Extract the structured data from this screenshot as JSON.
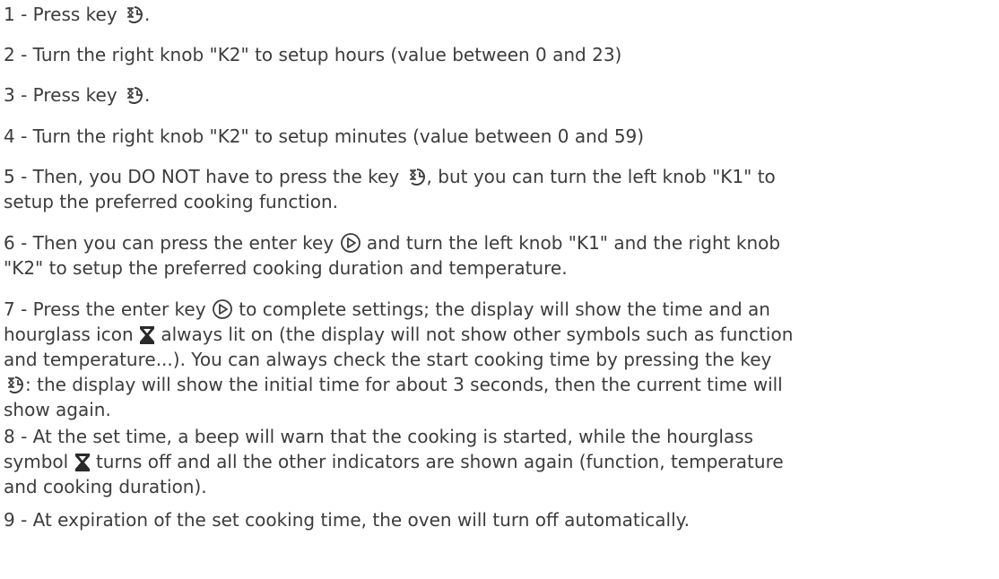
{
  "steps": [
    {
      "lines": [
        [
          "1 - Press key ",
          "timer-icon",
          "."
        ]
      ]
    },
    {
      "lines": [
        [
          "2 - Turn the right knob \"K2\" to setup hours (value between 0 and 23)"
        ]
      ]
    },
    {
      "lines": [
        [
          "3 - Press key ",
          "timer-icon",
          "."
        ]
      ]
    },
    {
      "lines": [
        [
          "4 - Turn the right knob \"K2\" to setup minutes (value between 0 and 59)"
        ]
      ]
    },
    {
      "lines": [
        [
          "5 - Then, you DO NOT have to press the key ",
          "timer-icon",
          ", but you can turn the left knob \"K1\" to"
        ],
        [
          "setup the preferred cooking function."
        ]
      ]
    },
    {
      "lines": [
        [
          "6 - Then you can press the enter key ",
          "enter-icon",
          " and turn the left knob \"K1\" and the right knob"
        ],
        [
          "\"K2\" to setup the preferred cooking duration and temperature."
        ]
      ]
    },
    {
      "lines": [
        [
          "7 - Press the enter key ",
          "enter-icon",
          " to complete settings; the display will show the time and an"
        ],
        [
          "hourglass icon ",
          "hourglass-icon",
          " always lit on (the display will not show other symbols such as function"
        ],
        [
          "and temperature...). You can always check the start cooking time by pressing the key"
        ],
        [
          "timer-icon",
          ": the display will show the initial time for about 3 seconds, then the current time will"
        ],
        [
          "show again."
        ]
      ]
    },
    {
      "lines": [
        [
          "8 - At the set time, a beep will warn that the cooking is started, while the hourglass"
        ],
        [
          "symbol ",
          "hourglass-icon",
          " turns off and all the other indicators are shown again (function, temperature"
        ],
        [
          "and cooking duration)."
        ]
      ]
    },
    {
      "lines": [
        [
          "9 - At expiration of the set cooking time, the oven will turn off automatically."
        ]
      ]
    }
  ]
}
